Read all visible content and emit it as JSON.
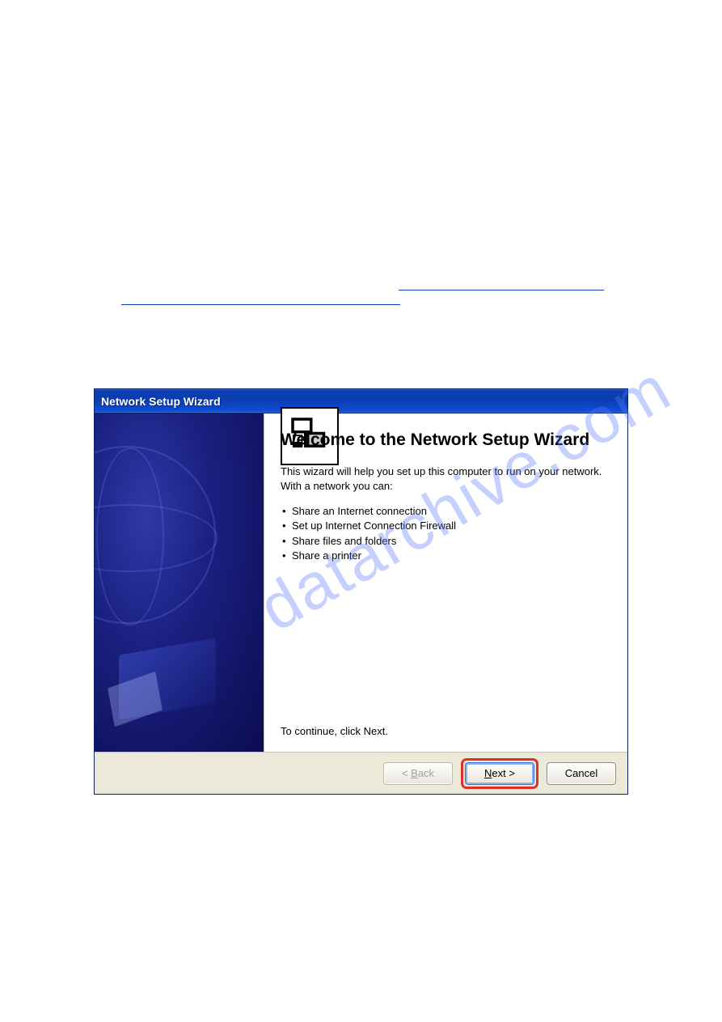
{
  "watermark": "datarchive.com",
  "dialog": {
    "title": "Network Setup Wizard",
    "heading": "Welcome to the Network Setup Wizard",
    "description": "This wizard will help you set up this computer to run on your network. With a network you can:",
    "bullets": [
      "Share an Internet connection",
      "Set up Internet Connection Firewall",
      "Share files and folders",
      "Share a printer"
    ],
    "continueText": "To continue, click Next.",
    "buttons": {
      "back_prefix": "< ",
      "back_letter": "B",
      "back_suffix": "ack",
      "next_letter": "N",
      "next_suffix": "ext >",
      "cancel": "Cancel"
    }
  }
}
